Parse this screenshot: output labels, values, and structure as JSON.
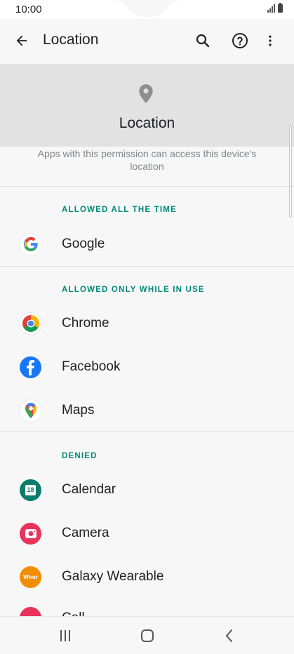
{
  "status_bar": {
    "time": "10:00"
  },
  "app_bar": {
    "title": "Location"
  },
  "header": {
    "title": "Location",
    "description": "Apps with this permission can access this device's location"
  },
  "sections": {
    "allowed_all": "ALLOWED ALL THE TIME",
    "allowed_in_use": "ALLOWED ONLY WHILE IN USE",
    "denied": "DENIED"
  },
  "apps": {
    "google": "Google",
    "chrome": "Chrome",
    "facebook": "Facebook",
    "maps": "Maps",
    "calendar": "Calendar",
    "camera": "Camera",
    "galaxy_wearable": "Galaxy Wearable",
    "cut_off": "Call"
  },
  "icons": {
    "calendar_day": "18",
    "wear": "Wear"
  },
  "colors": {
    "accent": "#00897b",
    "header_bg": "#e2e2e2",
    "facebook": "#1877f2",
    "calendar": "#0a7d6c",
    "camera": "#e8335a",
    "wear": "#f28c00"
  }
}
